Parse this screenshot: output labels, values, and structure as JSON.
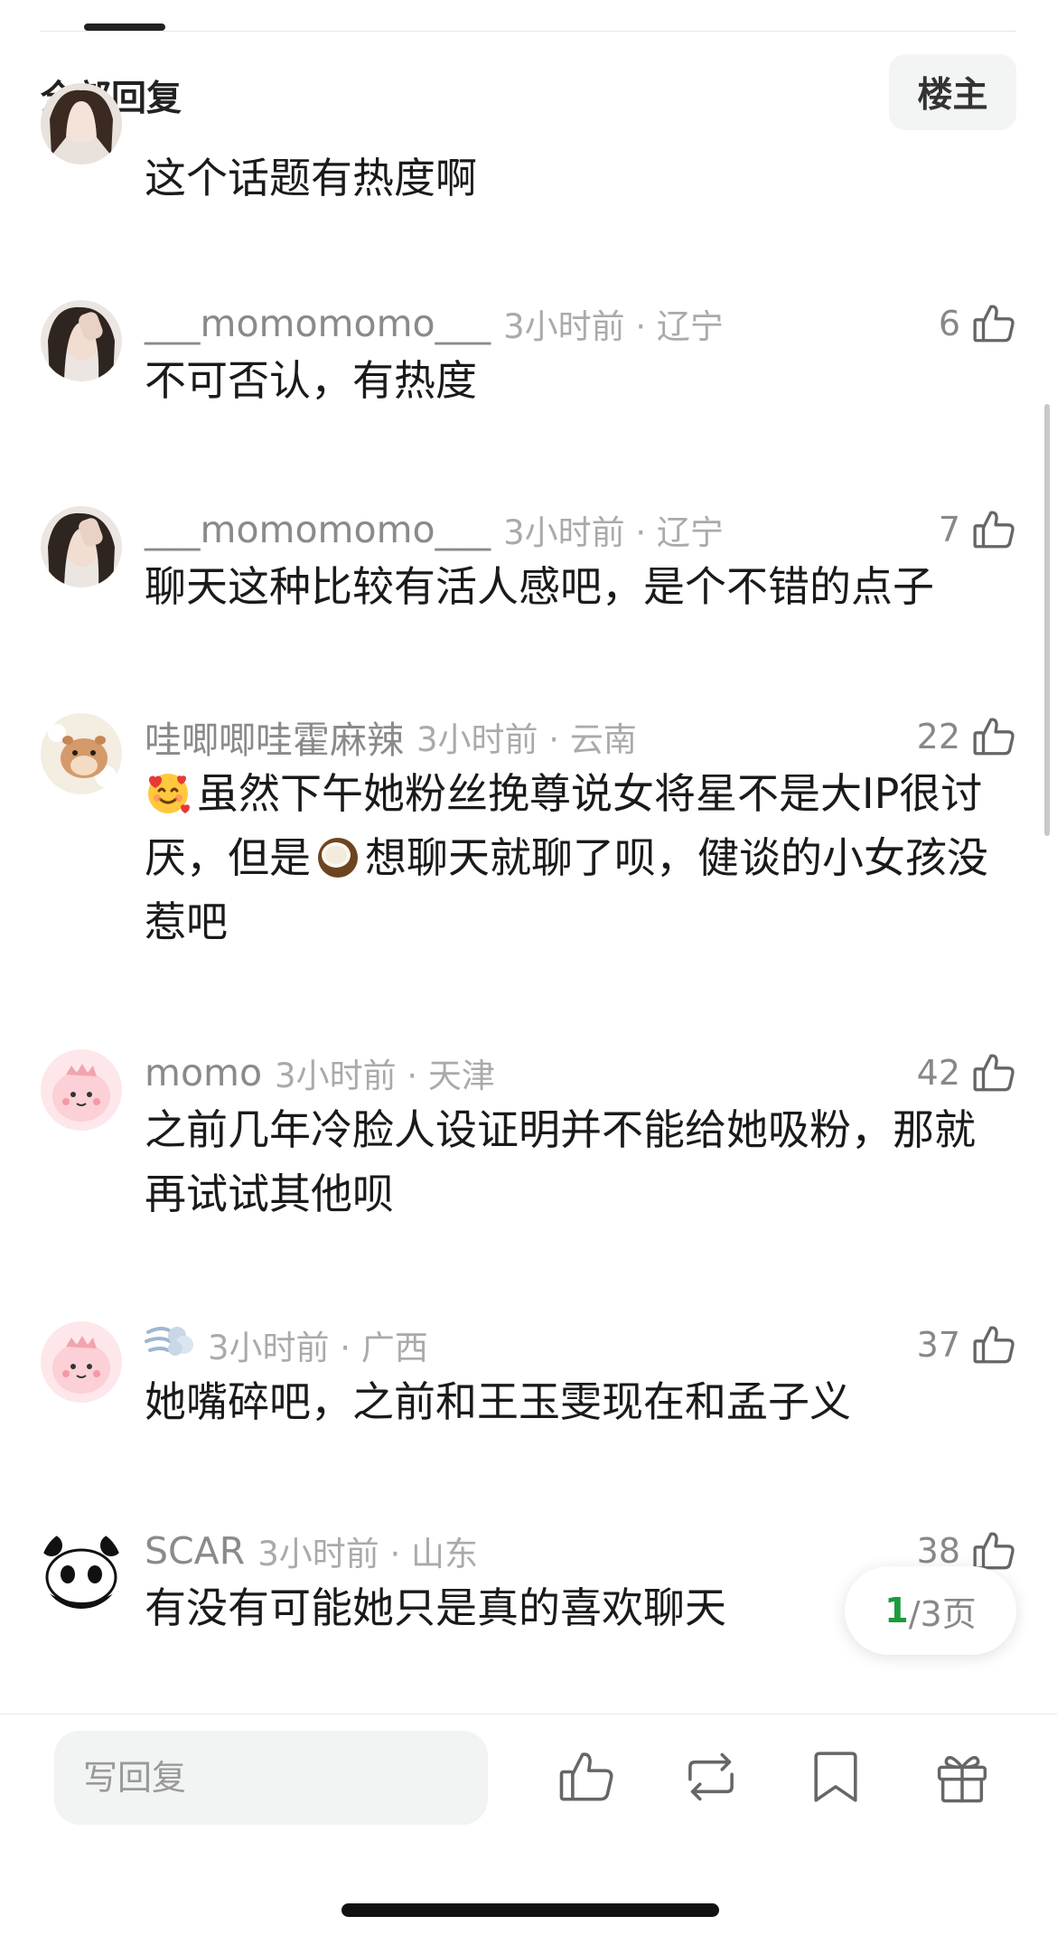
{
  "header": {
    "title": "全部回复",
    "op_button": "楼主"
  },
  "comments": [
    {
      "username": "",
      "time": "",
      "text": "这个话题有热度啊",
      "likes": ""
    },
    {
      "username": "___momomomo___",
      "time": "3小时前 · 辽宁",
      "text": "不可否认，有热度",
      "likes": "6"
    },
    {
      "username": "___momomomo___",
      "time": "3小时前 · 辽宁",
      "text": "聊天这种比较有活人感吧，是个不错的点子",
      "likes": "7"
    },
    {
      "username": "哇唧唧哇霍麻辣",
      "time": "3小时前 · 云南",
      "text_part1": "虽然下午她粉丝挽尊说女将星不是大IP很讨厌，但是",
      "text_part2": "想聊天就聊了呗，健谈的小女孩没惹吧",
      "likes": "22",
      "emoji_1": "smiling-face-with-hearts",
      "emoji_2": "coconut"
    },
    {
      "username": "momo",
      "time": "3小时前 · 天津",
      "text": "之前几年冷脸人设证明并不能给她吸粉，那就再试试其他呗",
      "likes": "42"
    },
    {
      "username_icon": "dash-emoji",
      "time": "3小时前 · 广西",
      "text": "她嘴碎吧，之前和王玉雯现在和孟子义",
      "likes": "37"
    },
    {
      "username": "SCAR",
      "time": "3小时前 · 山东",
      "text": "有没有可能她只是真的喜欢聊天",
      "likes": "38"
    }
  ],
  "pagination": {
    "current": "1",
    "total_label": "/3页"
  },
  "bottom_bar": {
    "reply_placeholder": "写回复"
  },
  "colors": {
    "accent_green": "#1d9a3e",
    "meta_gray": "#8a8a8a"
  }
}
